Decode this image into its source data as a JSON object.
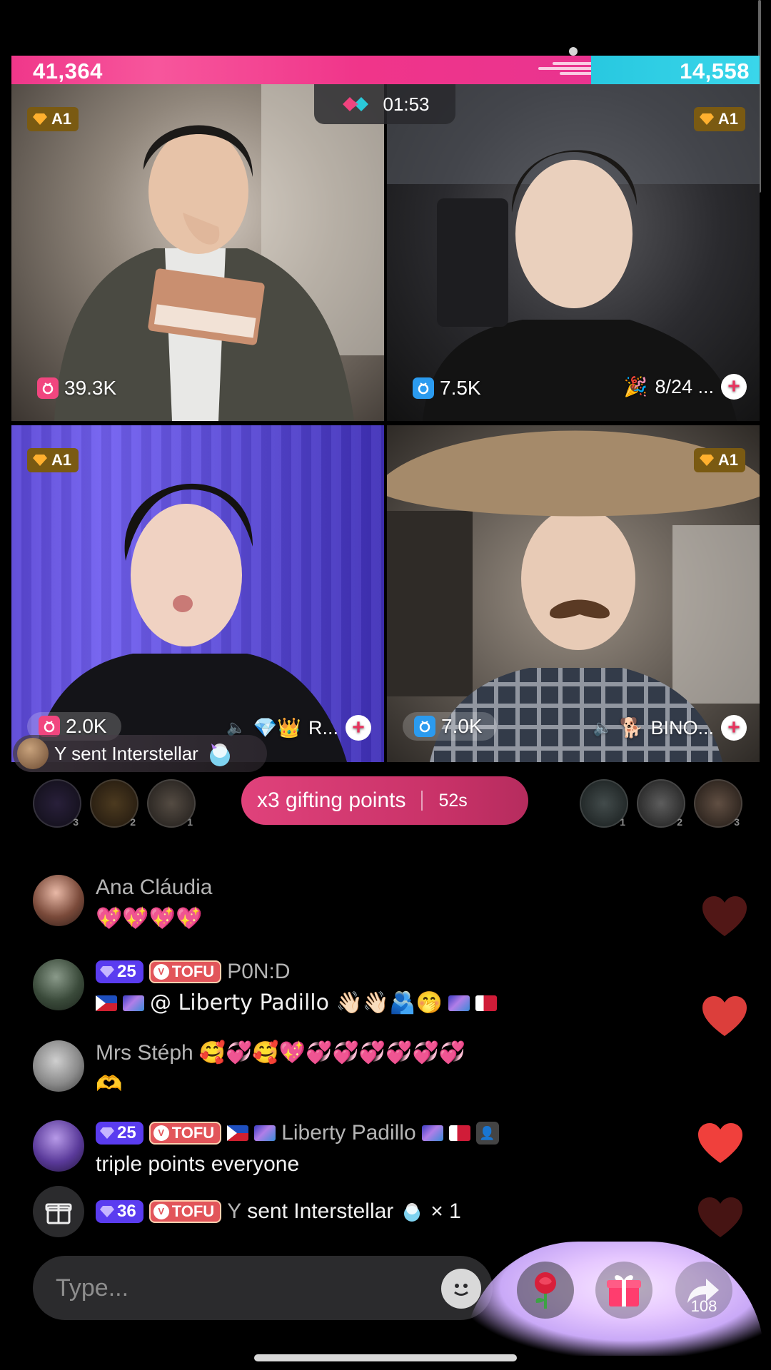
{
  "battle": {
    "left_score": "41,364",
    "right_score": "14,558",
    "timer": "01:53"
  },
  "tiles": [
    {
      "rank": "A1",
      "likes": "39.3K"
    },
    {
      "rank": "A1",
      "likes": "7.5K",
      "side_text": "8/24 ..."
    },
    {
      "rank": "A1",
      "likes": "2.0K",
      "side_text": "R..."
    },
    {
      "rank": "A1",
      "likes": "7.0K",
      "side_text": "BINO..."
    }
  ],
  "gift_toast": {
    "text": "Y sent Interstellar"
  },
  "gifting": {
    "label": "x3 gifting points",
    "countdown": "52s",
    "left_ranks": [
      "3",
      "2",
      "1"
    ],
    "right_ranks": [
      "1",
      "2",
      "3"
    ]
  },
  "chat": {
    "messages": [
      {
        "user": "Ana Cláudia",
        "text": "💖💖💖💖"
      },
      {
        "level": "25",
        "badge": "TOFU",
        "user": "P0N:D",
        "text": "@ Liberty Padillo 👋🏻👋🏻🫂🤭"
      },
      {
        "user": "Mrs Stéph",
        "text": "🥰💞🥰💖💞💞💞💞💞💞",
        "text2": "🫶"
      },
      {
        "level": "25",
        "badge": "TOFU",
        "user": "Liberty Padillo",
        "text": "triple points everyone"
      },
      {
        "level": "36",
        "badge": "TOFU",
        "user": "Y",
        "text": "sent Interstellar",
        "count": "× 1"
      }
    ]
  },
  "input": {
    "placeholder": "Type..."
  },
  "share": {
    "count": "108"
  },
  "colors": {
    "left_team": "#f0378a",
    "right_team": "#28c8e0",
    "multiplier": "#d03a70",
    "level_badge": "#5a3cf0",
    "tofu_badge": "#e2555a"
  }
}
